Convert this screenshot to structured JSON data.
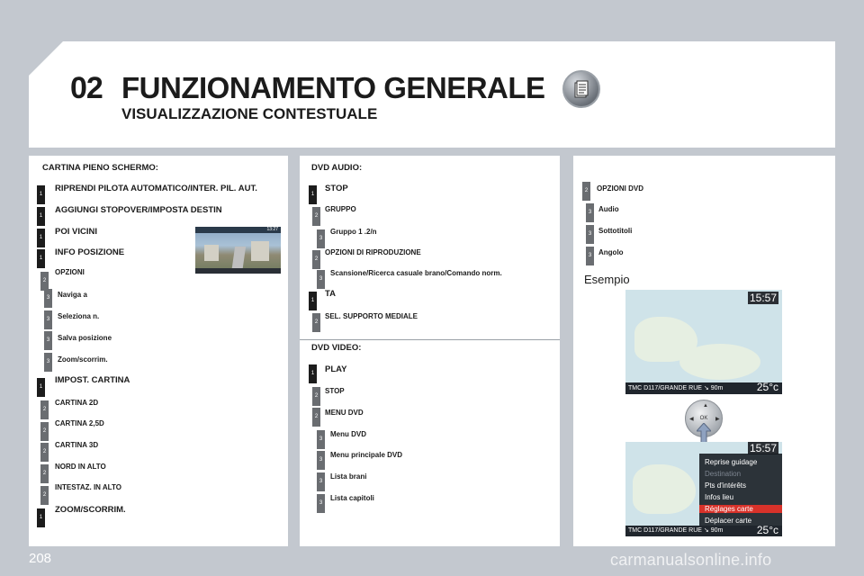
{
  "header": {
    "chapter_number": "02",
    "chapter_title": "FUNZIONAMENTO GENERALE",
    "subtitle": "VISUALIZZAZIONE CONTESTUALE",
    "icon": "document-icon"
  },
  "col1": {
    "heading": "CARTINA PIENO SCHERMO:",
    "items": [
      {
        "level": "1",
        "label": "RIPRENDI PILOTA AUTOMATICO/INTER. PIL. AUT."
      },
      {
        "level": "1",
        "label": "AGGIUNGI STOPOVER/IMPOSTA DESTIN"
      },
      {
        "level": "1",
        "label": "POI VICINI"
      },
      {
        "level": "1",
        "label": "INFO POSIZIONE"
      },
      {
        "level": "2",
        "label": "OPZIONI"
      },
      {
        "level": "3",
        "label": "Naviga a"
      },
      {
        "level": "3",
        "label": "Seleziona n."
      },
      {
        "level": "3",
        "label": "Salva posizione"
      },
      {
        "level": "3",
        "label": "Zoom/scorrim."
      },
      {
        "level": "1",
        "label": "IMPOST. CARTINA"
      },
      {
        "level": "2",
        "label": "CARTINA 2D"
      },
      {
        "level": "2",
        "label": "CARTINA 2,5D"
      },
      {
        "level": "2",
        "label": "CARTINA 3D"
      },
      {
        "level": "2",
        "label": "NORD IN ALTO"
      },
      {
        "level": "2",
        "label": "INTESTAZ. IN ALTO"
      },
      {
        "level": "1",
        "label": "ZOOM/SCORRIM."
      }
    ],
    "nav_shot_time": "13:27"
  },
  "col2": {
    "dvd_audio": {
      "heading": "DVD AUDIO:",
      "items": [
        {
          "level": "1",
          "label": "STOP"
        },
        {
          "level": "2",
          "label": "GRUPPO"
        },
        {
          "level": "3",
          "label": "Gruppo 1 .2/n"
        },
        {
          "level": "2",
          "label": "OPZIONI DI RIPRODUZIONE"
        },
        {
          "level": "3",
          "label": "Scansione/Ricerca casuale brano/Comando norm."
        },
        {
          "level": "1",
          "label": "TA"
        },
        {
          "level": "2",
          "label": "SEL. SUPPORTO MEDIALE"
        }
      ]
    },
    "dvd_video": {
      "heading": "DVD VIDEO:",
      "items": [
        {
          "level": "1",
          "label": "PLAY"
        },
        {
          "level": "2",
          "label": "STOP"
        },
        {
          "level": "2",
          "label": "MENU DVD"
        },
        {
          "level": "3",
          "label": "Menu DVD"
        },
        {
          "level": "3",
          "label": "Menu principale DVD"
        },
        {
          "level": "3",
          "label": "Lista brani"
        },
        {
          "level": "3",
          "label": "Lista capitoli"
        }
      ]
    }
  },
  "col3": {
    "items": [
      {
        "level": "2",
        "label": "OPZIONI DVD"
      },
      {
        "level": "3",
        "label": "Audio"
      },
      {
        "level": "3",
        "label": "Sottotitoli"
      },
      {
        "level": "3",
        "label": "Angolo"
      }
    ],
    "example_label": "Esempio",
    "map1": {
      "clock": "15:57",
      "bar": "TMC  D117/GRANDE RUE  ↘  90m",
      "temp": "25°c"
    },
    "knob_label": "OK",
    "map2": {
      "clock": "15:57",
      "menu": [
        "Reprise guidage",
        "Destination",
        "Pts d'intérêts",
        "Infos lieu",
        "Réglages carte",
        "Déplacer carte"
      ],
      "bar": "TMC  D117/GRANDE RUE  ↘  90m",
      "temp": "25°c"
    }
  },
  "footer": {
    "page_number": "208",
    "watermark": "carmanualsonline.info"
  }
}
